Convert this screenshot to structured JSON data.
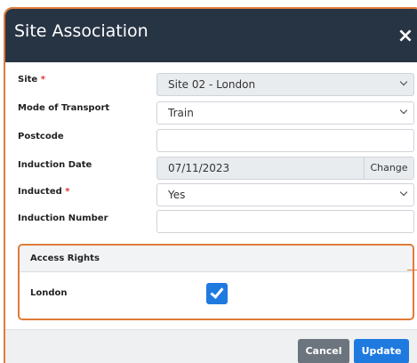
{
  "modal": {
    "title": "Site Association",
    "close_glyph": "×"
  },
  "form": {
    "site": {
      "label": "Site",
      "required_mark": "*",
      "value": "Site 02 - London"
    },
    "mode_of_transport": {
      "label": "Mode of Transport",
      "value": "Train"
    },
    "postcode": {
      "label": "Postcode",
      "value": ""
    },
    "induction_date": {
      "label": "Induction Date",
      "value": "07/11/2023",
      "change_label": "Change"
    },
    "inducted": {
      "label": "Inducted",
      "required_mark": "*",
      "value": "Yes"
    },
    "induction_number": {
      "label": "Induction Number",
      "value": ""
    }
  },
  "access_rights": {
    "heading": "Access Rights",
    "rows": [
      {
        "label": "London",
        "checked": true
      }
    ]
  },
  "footer": {
    "cancel_label": "Cancel",
    "update_label": "Update"
  },
  "colors": {
    "header_bg": "#273444",
    "highlight_border": "#e07b39",
    "primary": "#1f7ae0",
    "secondary": "#6c757d"
  }
}
